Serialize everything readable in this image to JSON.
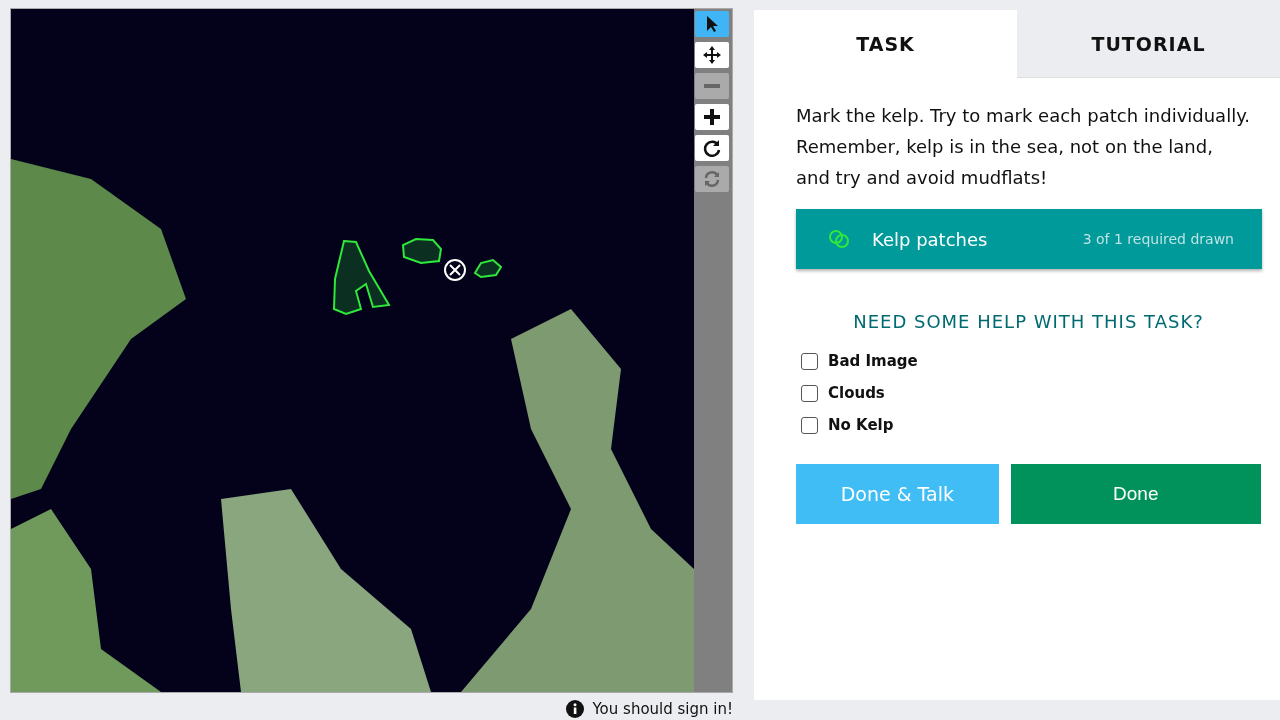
{
  "tools": [
    {
      "kind": "pointer",
      "selected": true,
      "disabled": false
    },
    {
      "kind": "move",
      "selected": false,
      "disabled": false
    },
    {
      "kind": "zoom-out",
      "selected": false,
      "disabled": true
    },
    {
      "kind": "zoom-in",
      "selected": false,
      "disabled": false
    },
    {
      "kind": "rotate",
      "selected": false,
      "disabled": false
    },
    {
      "kind": "reset",
      "selected": false,
      "disabled": true
    }
  ],
  "sign_in_notice": "You should sign in!",
  "tabs": [
    {
      "label": "TASK",
      "selected": true
    },
    {
      "label": "TUTORIAL",
      "selected": false
    }
  ],
  "instructions": "Mark the kelp. Try to mark each patch individually. Remember, kelp is in the sea, not on the land, and try and avoid mudflats!",
  "drawing_tool": {
    "label": "Kelp patches",
    "count": "3 of 1 required drawn",
    "color": "#2ee83a"
  },
  "help_heading": "NEED SOME HELP WITH THIS TASK?",
  "help_options": [
    {
      "label": "Bad Image",
      "checked": false
    },
    {
      "label": "Clouds",
      "checked": false
    },
    {
      "label": "No Kelp",
      "checked": false
    }
  ],
  "buttons": [
    {
      "kind": "talk",
      "label": "Done & Talk"
    },
    {
      "kind": "done",
      "label": "Done"
    }
  ]
}
